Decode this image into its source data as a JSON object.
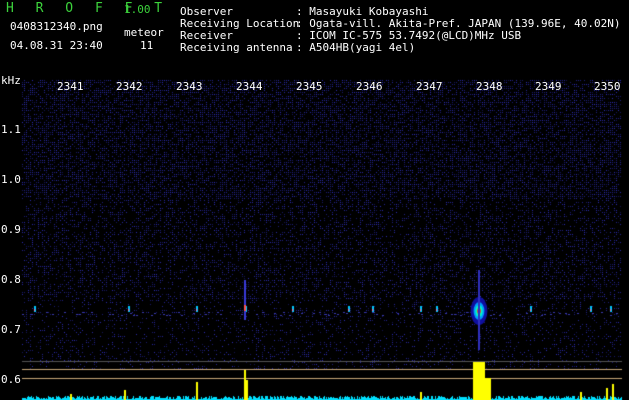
{
  "header": {
    "app_name": "H R O F F T",
    "version": "1.00",
    "filename": "0408312340.png",
    "meteor_label": "meteor",
    "date_time": "04.08.31 23:40",
    "meteor_count": "11",
    "info": [
      {
        "label": "Observer",
        "value": ": Masayuki Kobayashi"
      },
      {
        "label": "Receiving Location",
        "value": ": Ogata-vill. Akita-Pref. JAPAN (139.96E, 40.02N)"
      },
      {
        "label": "Receiver",
        "value": ": ICOM IC-575 53.7492(@LCD)MHz USB"
      },
      {
        "label": "Receiving antenna",
        "value": ": A504HB(yagi 4el)"
      }
    ]
  },
  "axis": {
    "unit": "kHz",
    "time_labels": [
      "2341",
      "2342",
      "2343",
      "2344",
      "2345",
      "2346",
      "2347",
      "2348",
      "2349",
      "2350"
    ],
    "freq_labels": [
      "1.1",
      "1.0",
      "0.9",
      "0.8",
      "0.7",
      "0.6"
    ]
  },
  "colors": {
    "header_green": "#3cd23c",
    "header_white": "#ffffff",
    "noise": "#1a1a7a",
    "signal_cyan": "#00e0ff",
    "signal_peak": "#ff3030",
    "level_yellow": "#ffff00",
    "guide_line": "#c8a878"
  }
}
